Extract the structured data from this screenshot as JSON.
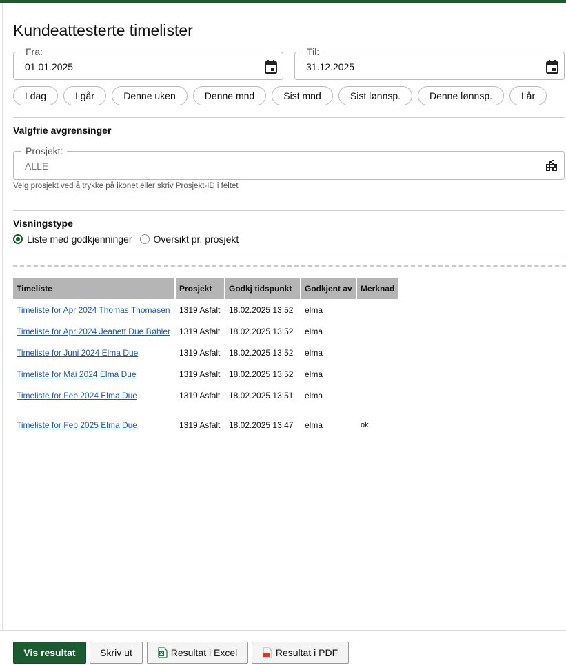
{
  "page": {
    "title": "Kundeattesterte timelister"
  },
  "dates": {
    "from": {
      "label": "Fra:",
      "value": "01.01.2025",
      "icon": "calendar-icon"
    },
    "to": {
      "label": "Til:",
      "value": "31.12.2025",
      "icon": "calendar-icon"
    }
  },
  "quick_ranges": [
    "I dag",
    "I går",
    "Denne uken",
    "Denne mnd",
    "Sist mnd",
    "Sist lønnsp.",
    "Denne lønnsp.",
    "I år"
  ],
  "optional": {
    "heading": "Valgfrie avgrensinger",
    "project": {
      "label": "Prosjekt:",
      "value": "ALLE",
      "icon": "building-icon"
    },
    "hint": "Velg prosjekt ved å trykke på ikonet eller skriv Prosjekt-ID i feltet"
  },
  "view_type": {
    "heading": "Visningstype",
    "options": [
      {
        "label": "Liste med godkjenninger",
        "checked": true
      },
      {
        "label": "Oversikt pr. prosjekt",
        "checked": false
      }
    ]
  },
  "table": {
    "headers": [
      "Timeliste",
      "Prosjekt",
      "Godkj tidspunkt",
      "Godkjent av",
      "Merknad"
    ],
    "rows": [
      [
        "Timeliste for Apr 2024 Thomas Thomasen",
        "1319 Asfalt",
        "18.02.2025 13:52",
        "elma",
        ""
      ],
      [
        "Timeliste for Apr 2024 Jeanett Due Bøhler",
        "1319 Asfalt",
        "18.02.2025 13:52",
        "elma",
        ""
      ],
      [
        "Timeliste for Juni 2024 Elma Due",
        "1319 Asfalt",
        "18.02.2025 13:52",
        "elma",
        ""
      ],
      [
        "Timeliste for Mai 2024 Elma Due",
        "1319 Asfalt",
        "18.02.2025 13:52",
        "elma",
        ""
      ],
      [
        "Timeliste for Feb 2024 Elma Due",
        "1319 Asfalt",
        "18.02.2025 13:51",
        "elma",
        ""
      ],
      [
        "Timeliste for Feb 2025 Elma Due",
        "1319 Asfalt",
        "18.02.2025 13:47",
        "elma",
        "ok"
      ]
    ]
  },
  "actions": {
    "show": "Vis resultat",
    "print": "Skriv ut",
    "excel": "Resultat i Excel",
    "pdf": "Resultat i PDF"
  },
  "colors": {
    "primary": "#1a5b30",
    "link": "#1f56b8",
    "table_header": "#b5b5b5"
  }
}
